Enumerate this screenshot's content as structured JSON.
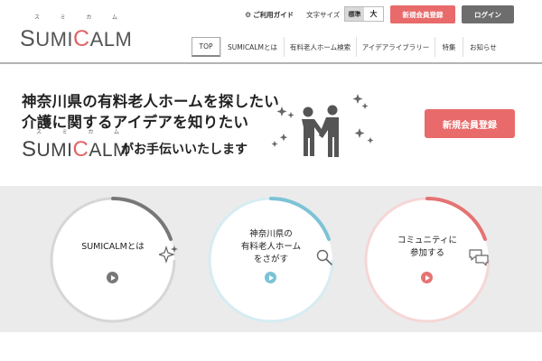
{
  "brand": {
    "ruby": [
      "ス",
      "ミ",
      "カ",
      "ム"
    ],
    "name_parts": [
      {
        "text": "S",
        "big": true,
        "red": false
      },
      {
        "text": "UMI",
        "big": false,
        "red": false
      },
      {
        "text": "C",
        "big": true,
        "red": true
      },
      {
        "text": "ALM",
        "big": false,
        "red": false
      }
    ]
  },
  "header": {
    "guide_label": "ご利用ガイド",
    "fontsize_label": "文字サイズ",
    "fontsize_options": {
      "standard": "標準",
      "large": "大"
    },
    "register_label": "新規会員登録",
    "login_label": "ログイン"
  },
  "nav": {
    "items": [
      {
        "label": "TOP"
      },
      {
        "label": "SUMICALMとは"
      },
      {
        "label": "有料老人ホーム検索"
      },
      {
        "label": "アイデアライブラリー"
      },
      {
        "label": "特集"
      },
      {
        "label": "お知らせ"
      }
    ]
  },
  "hero": {
    "line1": "神奈川県の有料老人ホームを探したい",
    "line2": "介護に関するアイデアを知りたい",
    "tail": "がお手伝いいたします",
    "register_label": "新規会員登録"
  },
  "features": [
    {
      "lines": [
        "SUMICALMとは"
      ],
      "color": "#777777",
      "icon": "sparkle-icon"
    },
    {
      "lines": [
        "神奈川県の",
        "有料老人ホーム",
        "をさがす"
      ],
      "color": "#7dc3d6",
      "icon": "magnifier-icon"
    },
    {
      "lines": [
        "コミュニティに",
        "参加する"
      ],
      "color": "#e57373",
      "icon": "chat-icon"
    }
  ],
  "colors": {
    "accent_red": "#e86a6a",
    "login_gray": "#6d6d6d",
    "band_gray": "#ebebeb"
  }
}
